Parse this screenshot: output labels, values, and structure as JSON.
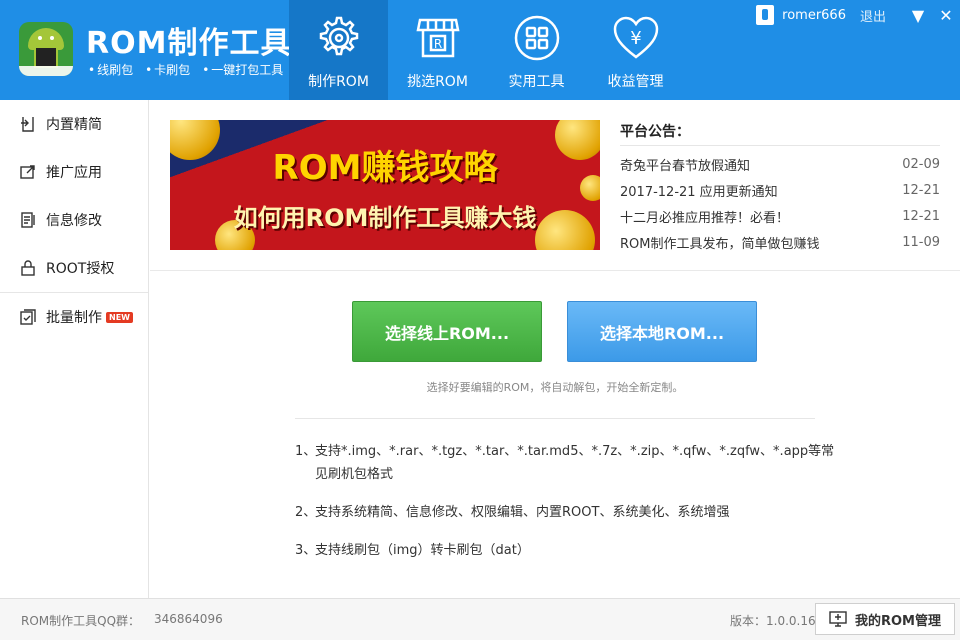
{
  "header": {
    "app_title": "ROM制作工具",
    "tags": [
      "线刷包",
      "卡刷包",
      "一键打包工具"
    ],
    "nav": [
      {
        "label": "制作ROM",
        "icon": "gear-disc-icon",
        "active": true
      },
      {
        "label": "挑选ROM",
        "icon": "store-icon",
        "active": false
      },
      {
        "label": "实用工具",
        "icon": "grid-tools-icon",
        "active": false
      },
      {
        "label": "收益管理",
        "icon": "heart-yen-icon",
        "active": false
      }
    ],
    "user": {
      "name": "romer666",
      "logout": "退出"
    },
    "menu_glyph": "▼",
    "close_glyph": "✕"
  },
  "sidebar": {
    "items": [
      {
        "label": "内置精简",
        "icon": "import-icon"
      },
      {
        "label": "推广应用",
        "icon": "promote-icon"
      },
      {
        "label": "信息修改",
        "icon": "edit-doc-icon"
      },
      {
        "label": "ROOT授权",
        "icon": "lock-icon"
      },
      {
        "label": "批量制作",
        "icon": "batch-icon",
        "badge": "NEW"
      }
    ]
  },
  "banner": {
    "line1": "ROM赚钱攻略",
    "line2": "如何用ROM制作工具赚大钱"
  },
  "notices": {
    "title": "平台公告：",
    "items": [
      {
        "text": "奇兔平台春节放假通知",
        "date": "02-09"
      },
      {
        "text": "2017-12-21 应用更新通知",
        "date": "12-21"
      },
      {
        "text": "十二月必推应用推荐！必看！",
        "date": "12-21"
      },
      {
        "text": "ROM制作工具发布，简单做包赚钱",
        "date": "11-09"
      }
    ]
  },
  "actions": {
    "online": "选择线上ROM...",
    "local": "选择本地ROM...",
    "hint": "选择好要编辑的ROM，将自动解包，开始全新定制。"
  },
  "features": [
    {
      "num": "1、",
      "text": "支持*.img、*.rar、*.tgz、*.tar、*.tar.md5、*.7z、*.zip、*.qfw、*.zqfw、*.app等常见刷机包格式"
    },
    {
      "num": "2、",
      "text": "支持系统精简、信息修改、权限编辑、内置ROOT、系统美化、系统增强"
    },
    {
      "num": "3、",
      "text": "支持线刷包（img）转卡刷包（dat）"
    }
  ],
  "footer": {
    "qq_label": "ROM制作工具QQ群：",
    "qq_number": "346864096",
    "version": "版本：1.0.0.16",
    "my_rom": "我的ROM管理"
  },
  "colors": {
    "header": "#1f8ee6",
    "nav_active": "#1577c8",
    "btn_online": "#4cb848",
    "btn_local": "#4aa6ee",
    "banner": "#c4161c"
  }
}
